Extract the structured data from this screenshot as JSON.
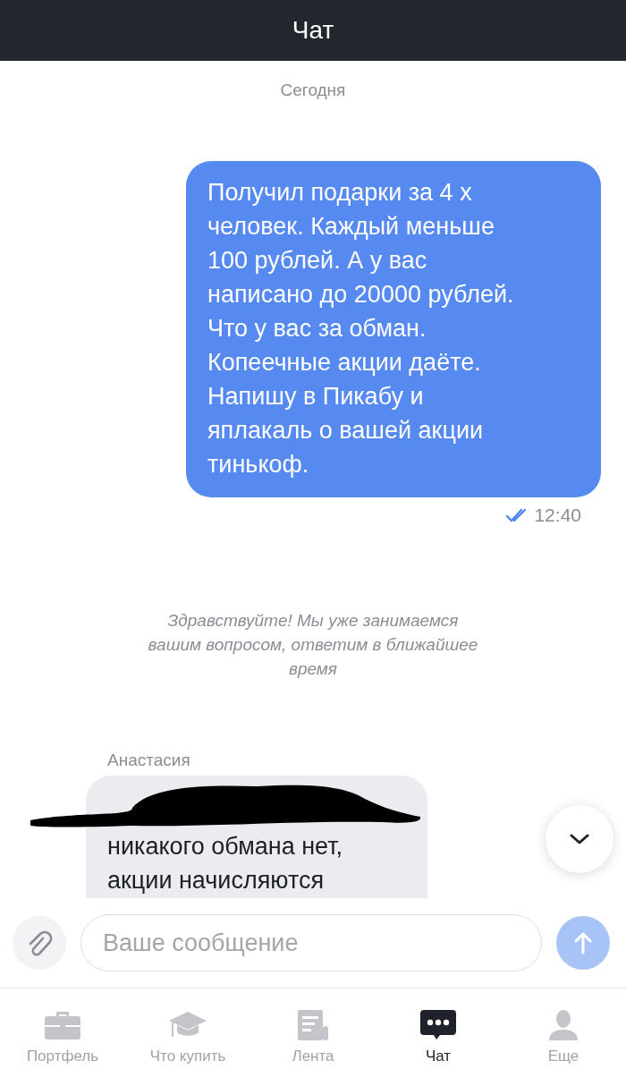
{
  "header": {
    "title": "Чат"
  },
  "chat": {
    "date": "Сегодня",
    "messages": [
      {
        "kind": "outgoing",
        "text": "Получил подарки за 4 х\nчеловек. Каждый меньше\n100 рублей. А у вас\nнаписано до 20000 рублей.\nЧто у вас за обман.\nКопеечные акции даёте.\nНапишу в Пикабу и\nяплакаль о вашей акции\nтинькоф.",
        "time": "12:40",
        "read": true
      },
      {
        "kind": "system",
        "text": "Здравствуйте! Мы уже занимаемся\nвашим вопросом, ответим в ближайшее\nвремя"
      },
      {
        "kind": "incoming",
        "author": "Анастасия",
        "redacted": true,
        "text": "никакого обмана нет,\nакции начисляются"
      }
    ]
  },
  "composer": {
    "placeholder": "Ваше сообщение",
    "send_enabled": false
  },
  "tabs": [
    {
      "label": "Портфель",
      "kind": "briefcase",
      "selected": false
    },
    {
      "label": "Что купить",
      "kind": "cap",
      "selected": false
    },
    {
      "label": "Лента",
      "kind": "news",
      "selected": false
    },
    {
      "label": "Чат",
      "kind": "chat",
      "selected": true
    },
    {
      "label": "Еще",
      "kind": "person",
      "selected": false
    }
  ]
}
